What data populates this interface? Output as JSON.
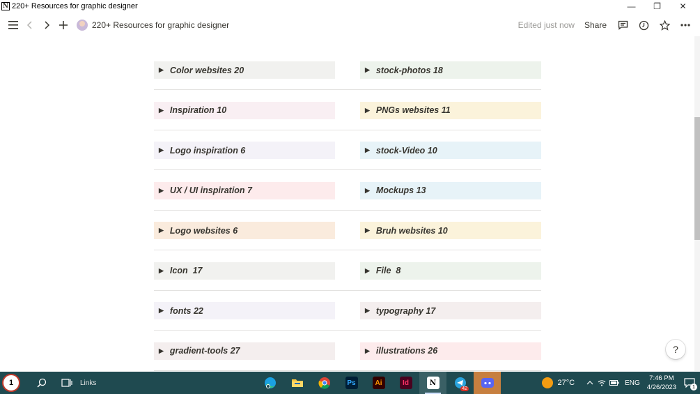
{
  "window": {
    "title": "220+ Resources for graphic designer",
    "app_icon_letter": "N",
    "minimize": "—",
    "restore": "❐",
    "close": "✕"
  },
  "topbar": {
    "breadcrumb": "220+ Resources for graphic designer",
    "edited": "Edited just now",
    "share": "Share"
  },
  "toggles": [
    {
      "left": {
        "label": "Color websites 20",
        "color": "#f1f1ef"
      },
      "right": {
        "label": "stock-photos 18",
        "color": "#edf3ec"
      }
    },
    {
      "left": {
        "label": "Inspiration 10",
        "color": "#f9eff3"
      },
      "right": {
        "label": "PNGs websites 11",
        "color": "#fbf3db"
      }
    },
    {
      "left": {
        "label": "Logo inspiration 6",
        "color": "#f4f2f8"
      },
      "right": {
        "label": "stock-Video 10",
        "color": "#e7f3f8"
      }
    },
    {
      "left": {
        "label": "UX / UI inspiration 7",
        "color": "#fdebec"
      },
      "right": {
        "label": "Mockups 13",
        "color": "#e7f3f8"
      }
    },
    {
      "left": {
        "label": "Logo websites 6",
        "color": "#faebdd"
      },
      "right": {
        "label": "Bruh websites 10",
        "color": "#fbf3db"
      }
    },
    {
      "left": {
        "label": "Icon  17",
        "color": "#f1f1ef"
      },
      "right": {
        "label": "File  8",
        "color": "#edf3ec"
      }
    },
    {
      "left": {
        "label": "fonts 22",
        "color": "#f4f2f8"
      },
      "right": {
        "label": "typography 17",
        "color": "#f4eeee"
      }
    },
    {
      "left": {
        "label": "gradient-tools 27",
        "color": "#f4eeee"
      },
      "right": {
        "label": "illustrations 26",
        "color": "#fdebec"
      }
    }
  ],
  "help_label": "?",
  "taskbar": {
    "start_label": "1",
    "links_label": "Links",
    "apps": [
      {
        "name": "edge",
        "label": ""
      },
      {
        "name": "file-explorer",
        "label": ""
      },
      {
        "name": "chrome",
        "label": ""
      },
      {
        "name": "photoshop",
        "label": "Ps"
      },
      {
        "name": "illustrator",
        "label": "Ai"
      },
      {
        "name": "indesign",
        "label": "Id"
      },
      {
        "name": "notion",
        "label": "N"
      },
      {
        "name": "telegram",
        "label": "",
        "badge": "42"
      },
      {
        "name": "discord",
        "label": ""
      }
    ],
    "temperature": "27°C",
    "language": "ENG",
    "time": "7:46 PM",
    "date": "4/26/2023",
    "notification_count": "1"
  }
}
